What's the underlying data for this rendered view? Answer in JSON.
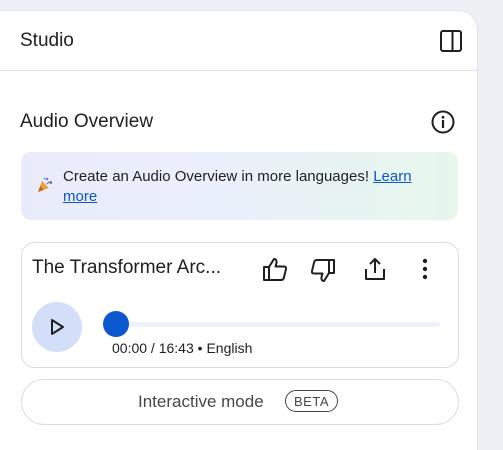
{
  "header": {
    "title": "Studio",
    "collapse_icon": "panel-collapse-icon"
  },
  "audio_overview": {
    "title": "Audio Overview",
    "info_icon": "info-icon",
    "banner": {
      "icon": "party-popper-icon",
      "text": "Create an Audio Overview in more languages! ",
      "link_text": "Learn more"
    }
  },
  "player": {
    "title": "The Transformer Arc...",
    "actions": [
      "thumbs-up-icon",
      "thumbs-down-icon",
      "share-icon",
      "more-vert-icon"
    ],
    "play_icon": "play-icon",
    "progress": 0,
    "current_time": "00:00",
    "duration": "16:43",
    "separator": " / ",
    "bullet": " • ",
    "language": "English"
  },
  "interactive": {
    "label": "Interactive mode",
    "badge": "BETA"
  },
  "colors": {
    "accent": "#0b57d0",
    "play_bg": "#d3dff8",
    "text": "#1f1f1f"
  }
}
